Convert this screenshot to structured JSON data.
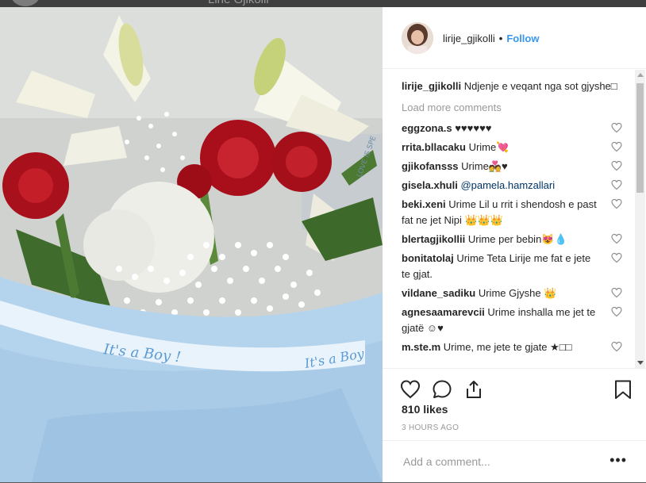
{
  "background_strip": {
    "name": "Lirie Gjikolli"
  },
  "post": {
    "username": "lirije_gjikolli",
    "separator": "•",
    "follow_label": "Follow",
    "caption_username": "lirije_gjikolli",
    "caption_text": "Ndjenje e veqant nga sot gjyshe□",
    "load_more": "Load more comments",
    "comments": [
      {
        "user": "eggzona.s",
        "text": "♥♥♥♥♥♥"
      },
      {
        "user": "rrita.bllacaku",
        "text": "Urime💘"
      },
      {
        "user": "gjikofansss",
        "text": "Urime💑♥"
      },
      {
        "user": "gisela.xhuli",
        "text": "@pamela.hamzallari",
        "is_mention": true
      },
      {
        "user": "beki.xeni",
        "text": "Urime Lil u rrit i shendosh e past fat ne jet Nipi 👑👑👑"
      },
      {
        "user": "blertagjikollii",
        "text": "Urime per bebin😻💧"
      },
      {
        "user": "bonitatolaj",
        "text": "Urime Teta Lirije me fat e jete te gjat."
      },
      {
        "user": "vildane_sadiku",
        "text": "Urime Gjyshe 👑"
      },
      {
        "user": "agnesaamarevcii",
        "text": "Urime inshalla me jet te gjatë ☺♥"
      },
      {
        "user": "m.ste.m",
        "text": "Urime, me jete te gjate ★□□"
      }
    ],
    "likes_text": "810 likes",
    "time_text": "3 HOURS AGO",
    "add_comment_placeholder": "Add a comment...",
    "more_label": "•••"
  },
  "photo": {
    "ribbon_text": "It's a Boy !",
    "ribbon_text_2": "It's a Boy",
    "tag_text": "LOVE IS SPE"
  },
  "colors": {
    "accent": "#3897f0",
    "rose": "#b3121e",
    "wrap_blue": "#b9d7ee"
  }
}
